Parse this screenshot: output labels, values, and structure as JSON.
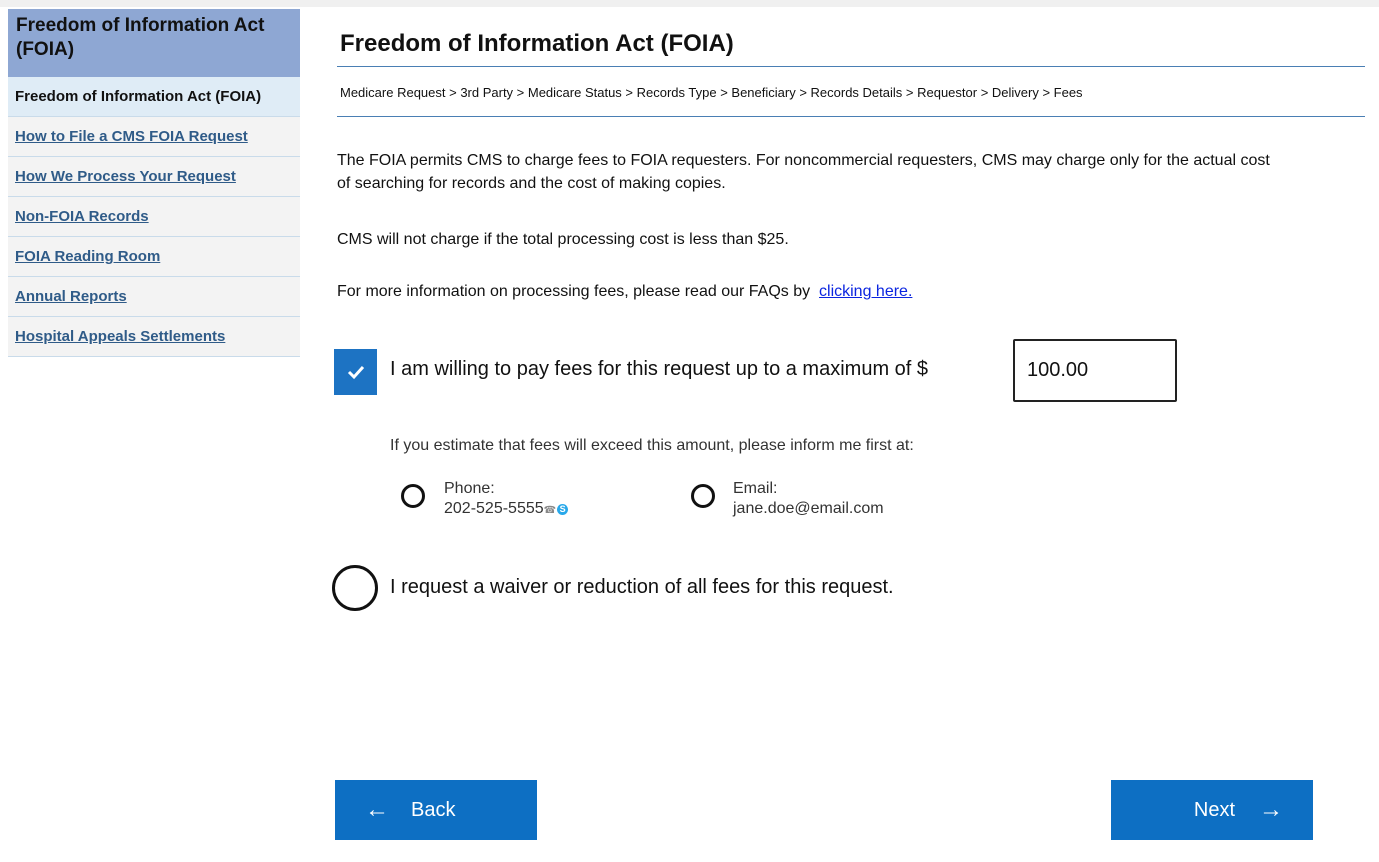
{
  "sidebar": {
    "header": "Freedom of Information Act (FOIA)",
    "items": [
      {
        "label": "Freedom of Information Act (FOIA)",
        "current": true
      },
      {
        "label": "How to File a CMS FOIA Request"
      },
      {
        "label": "How We Process Your Request"
      },
      {
        "label": "Non-FOIA Records"
      },
      {
        "label": "FOIA Reading Room"
      },
      {
        "label": "Annual Reports"
      },
      {
        "label": "Hospital Appeals Settlements"
      }
    ]
  },
  "main": {
    "title": "Freedom of Information Act (FOIA)",
    "breadcrumb": "Medicare Request > 3rd Party > Medicare Status > Records Type > Beneficiary > Records Details > Requestor > Delivery > Fees",
    "para1": "The FOIA permits CMS to charge fees to FOIA requesters. For noncommercial requesters, CMS may charge only for the actual cost of searching for records and the cost of making copies.",
    "para2": "CMS will not charge if the total processing cost is less than $25.",
    "para3_prefix": "For more information on processing fees, please read our FAQs by",
    "para3_link": "clicking here.",
    "fee_checkbox_checked": true,
    "fee_label": "I am willing to pay fees for this request up to a maximum of $",
    "fee_amount": "100.00",
    "inform_text": "If you estimate that fees will exceed this amount, please inform me first at:",
    "phone_label": "Phone:",
    "phone_value": "202-525-5555",
    "email_label": "Email:",
    "email_value": "jane.doe@email.com",
    "waiver_label": "I request a waiver or reduction of all fees for this request."
  },
  "buttons": {
    "back": "Back",
    "next": "Next"
  },
  "colors": {
    "accent": "#0d6fc3",
    "sidebar_header": "#8ea7d3",
    "link": "#0b25e0"
  }
}
